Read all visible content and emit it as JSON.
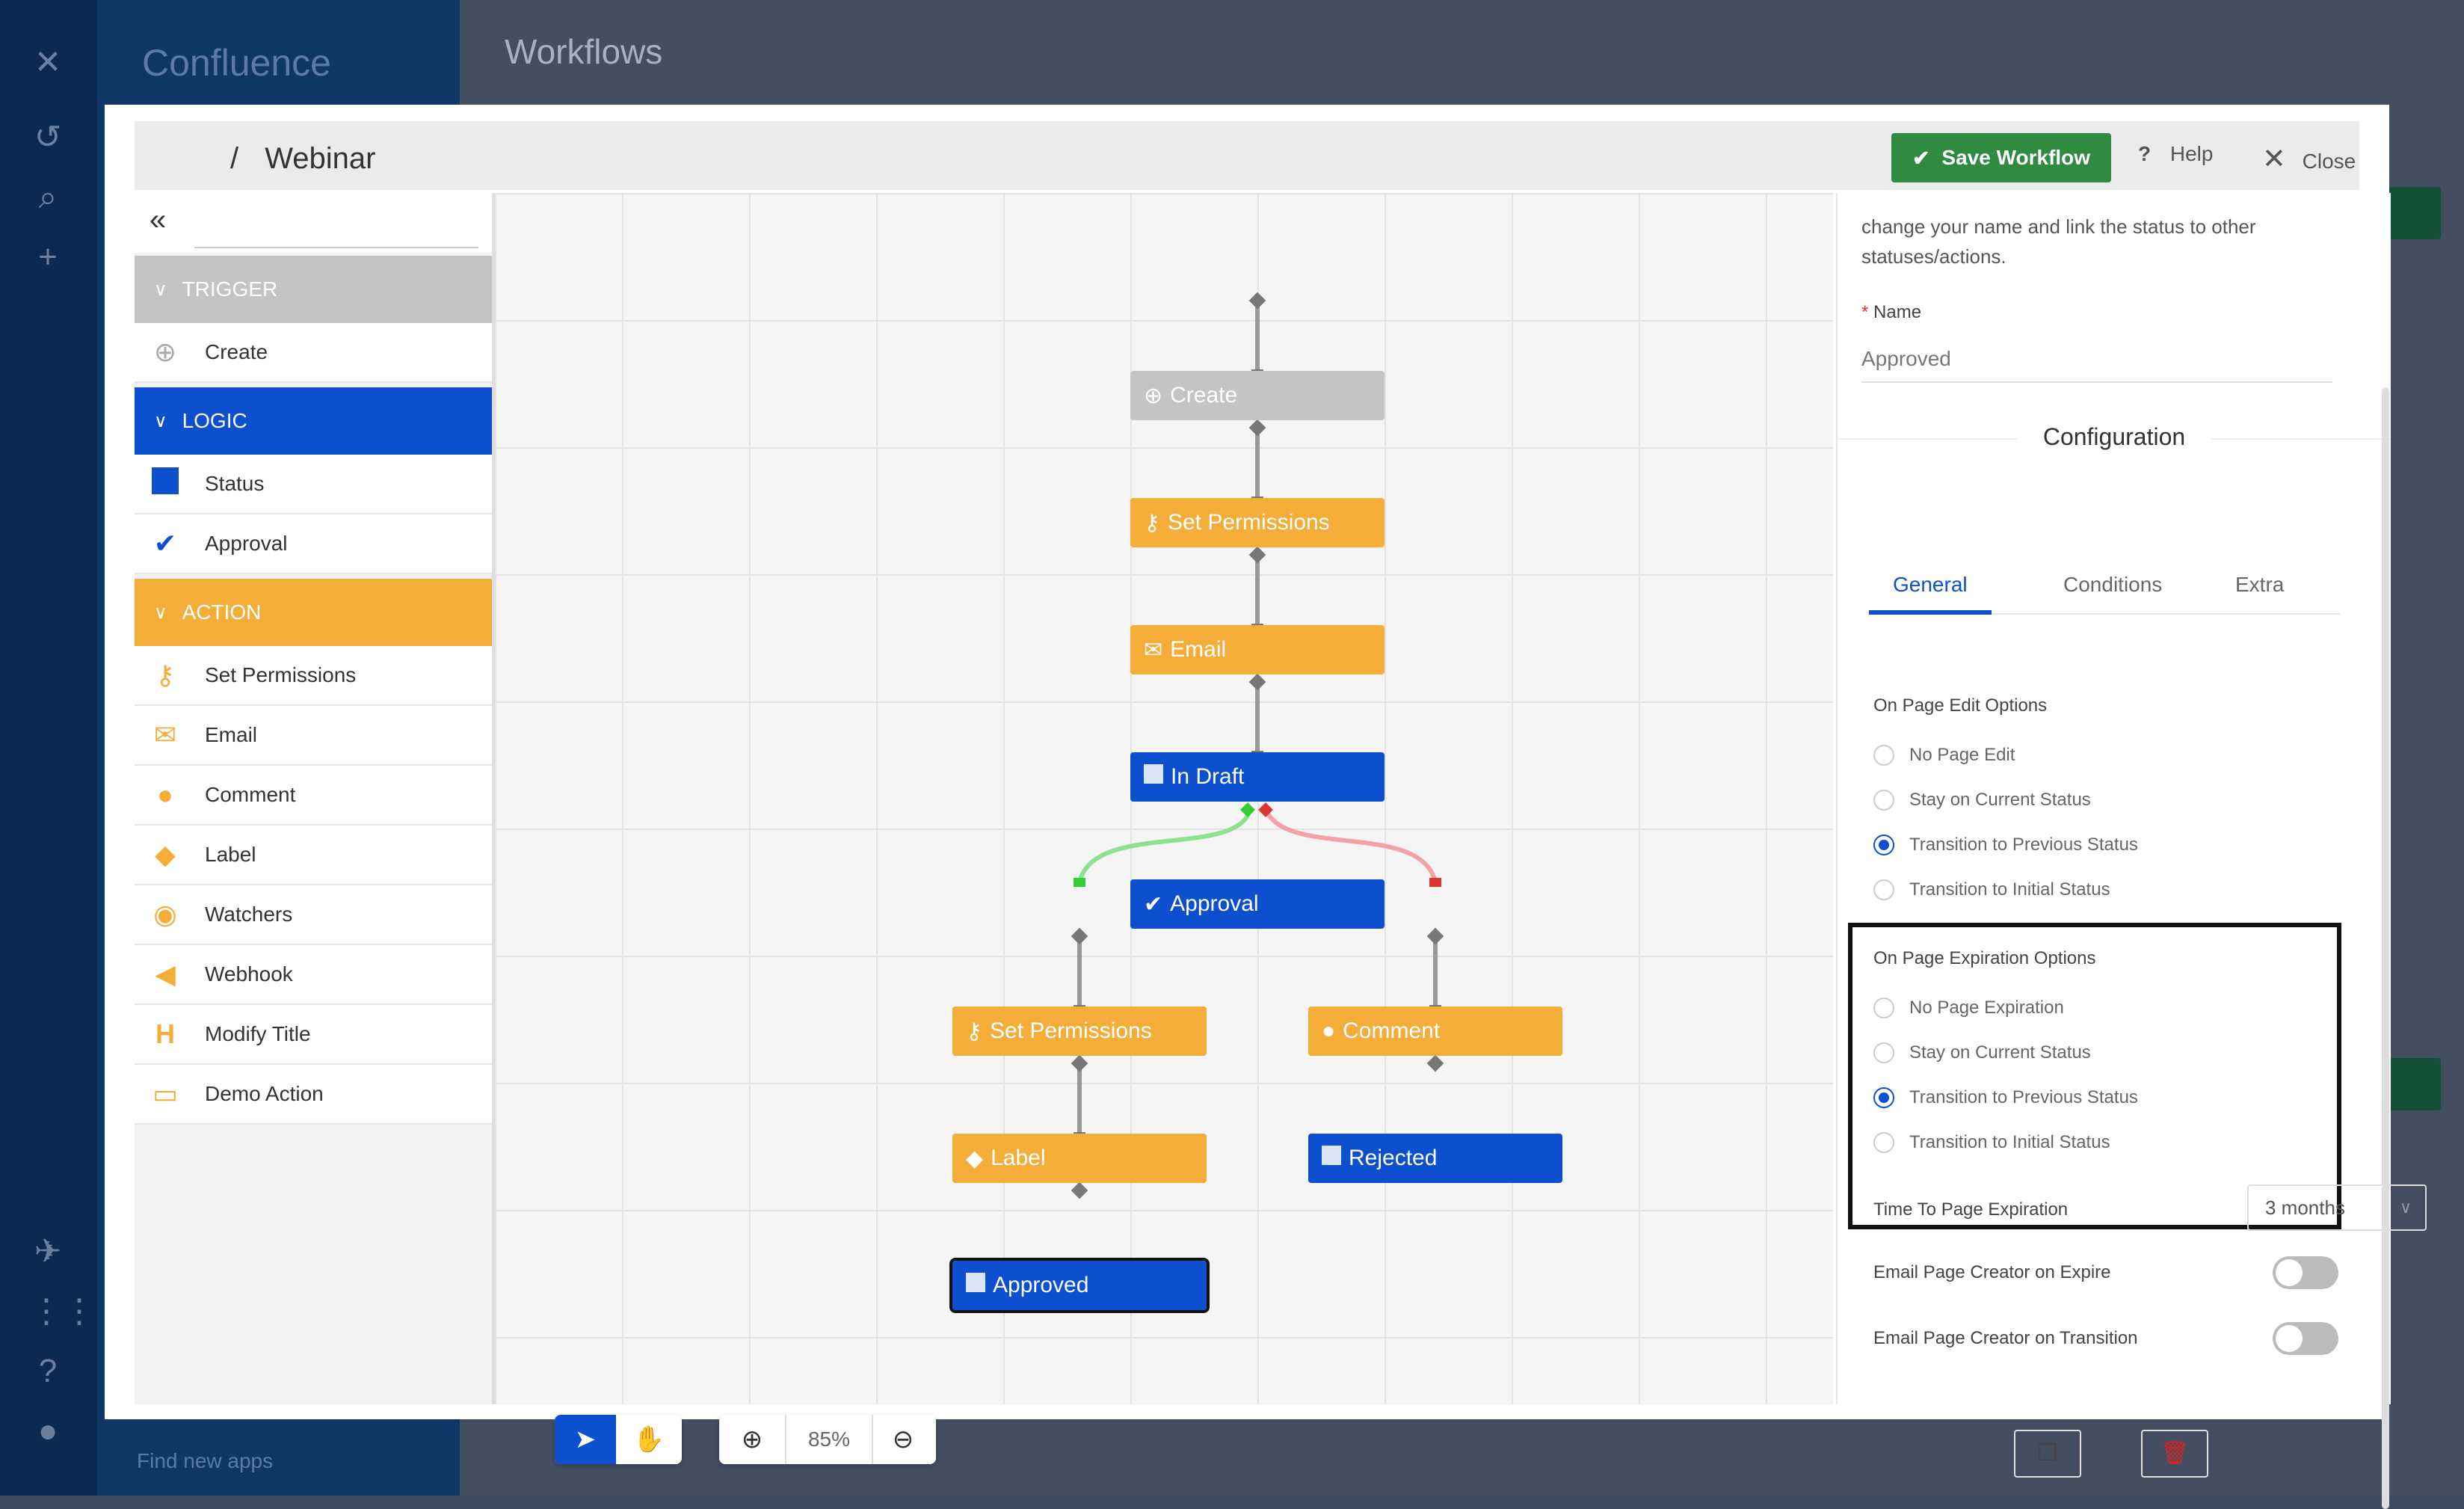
{
  "app": {
    "name": "Confluence",
    "page_title": "Workflows",
    "find_apps": "Find new apps"
  },
  "modal": {
    "breadcrumb_sep": "/",
    "breadcrumb_name": "Webinar",
    "save_label": "Save Workflow",
    "help_label": "Help",
    "close_label": "Close"
  },
  "palette": {
    "collapse_glyph": "«",
    "sections": [
      {
        "label": "TRIGGER",
        "color": "#c4c4c4"
      },
      {
        "label": "LOGIC",
        "color": "#0c4fcf"
      },
      {
        "label": "ACTION",
        "color": "#f5ad3a"
      }
    ],
    "trigger_items": [
      {
        "label": "Create",
        "icon": "plus-circle-icon"
      }
    ],
    "logic_items": [
      {
        "label": "Status",
        "icon": "square-icon"
      },
      {
        "label": "Approval",
        "icon": "check-icon"
      }
    ],
    "action_items": [
      {
        "label": "Set Permissions",
        "icon": "key-icon"
      },
      {
        "label": "Email",
        "icon": "envelope-icon"
      },
      {
        "label": "Comment",
        "icon": "speech-bubble-icon"
      },
      {
        "label": "Label",
        "icon": "tag-icon"
      },
      {
        "label": "Watchers",
        "icon": "eye-icon"
      },
      {
        "label": "Webhook",
        "icon": "megaphone-icon"
      },
      {
        "label": "Modify Title",
        "icon": "heading-icon"
      },
      {
        "label": "Demo Action",
        "icon": "monitor-icon"
      }
    ]
  },
  "canvas": {
    "nodes": [
      {
        "label": "Create",
        "kind": "trigger"
      },
      {
        "label": "Set Permissions",
        "kind": "action"
      },
      {
        "label": "Email",
        "kind": "action"
      },
      {
        "label": "In Draft",
        "kind": "status"
      },
      {
        "label": "Approval",
        "kind": "approval"
      },
      {
        "label": "Set Permissions",
        "kind": "action"
      },
      {
        "label": "Comment",
        "kind": "action"
      },
      {
        "label": "Label",
        "kind": "action"
      },
      {
        "label": "Rejected",
        "kind": "status"
      },
      {
        "label": "Approved",
        "kind": "status",
        "selected": true
      }
    ],
    "zoom": "85%"
  },
  "panel": {
    "intro_line1": "change your name and link the status to other",
    "intro_line2": "statuses/actions.",
    "name_required": "*",
    "name_label": "Name",
    "name_value": "Approved",
    "config_title": "Configuration",
    "tabs": [
      "General",
      "Conditions",
      "Extra"
    ],
    "active_tab": "General",
    "edit_options_title": "On Page Edit Options",
    "edit_options": [
      "No Page Edit",
      "Stay on Current Status",
      "Transition to Previous Status",
      "Transition to Initial Status"
    ],
    "edit_selected": "Transition to Previous Status",
    "expiry_options_title": "On Page Expiration Options",
    "expiry_options": [
      "No Page Expiration",
      "Stay on Current Status",
      "Transition to Previous Status",
      "Transition to Initial Status"
    ],
    "expiry_selected": "Transition to Previous Status",
    "time_label": "Time To Page Expiration",
    "time_value": "3 months",
    "email_expire_label": "Email Page Creator on Expire",
    "email_expire_on": false,
    "email_transition_label": "Email Page Creator on Transition",
    "email_transition_on": false
  },
  "colors": {
    "orange": "#f5ad3a",
    "blue": "#0c4fcf",
    "grey": "#c4c4c4",
    "save_green": "#2e8b3f",
    "delete_red": "#e02020"
  }
}
